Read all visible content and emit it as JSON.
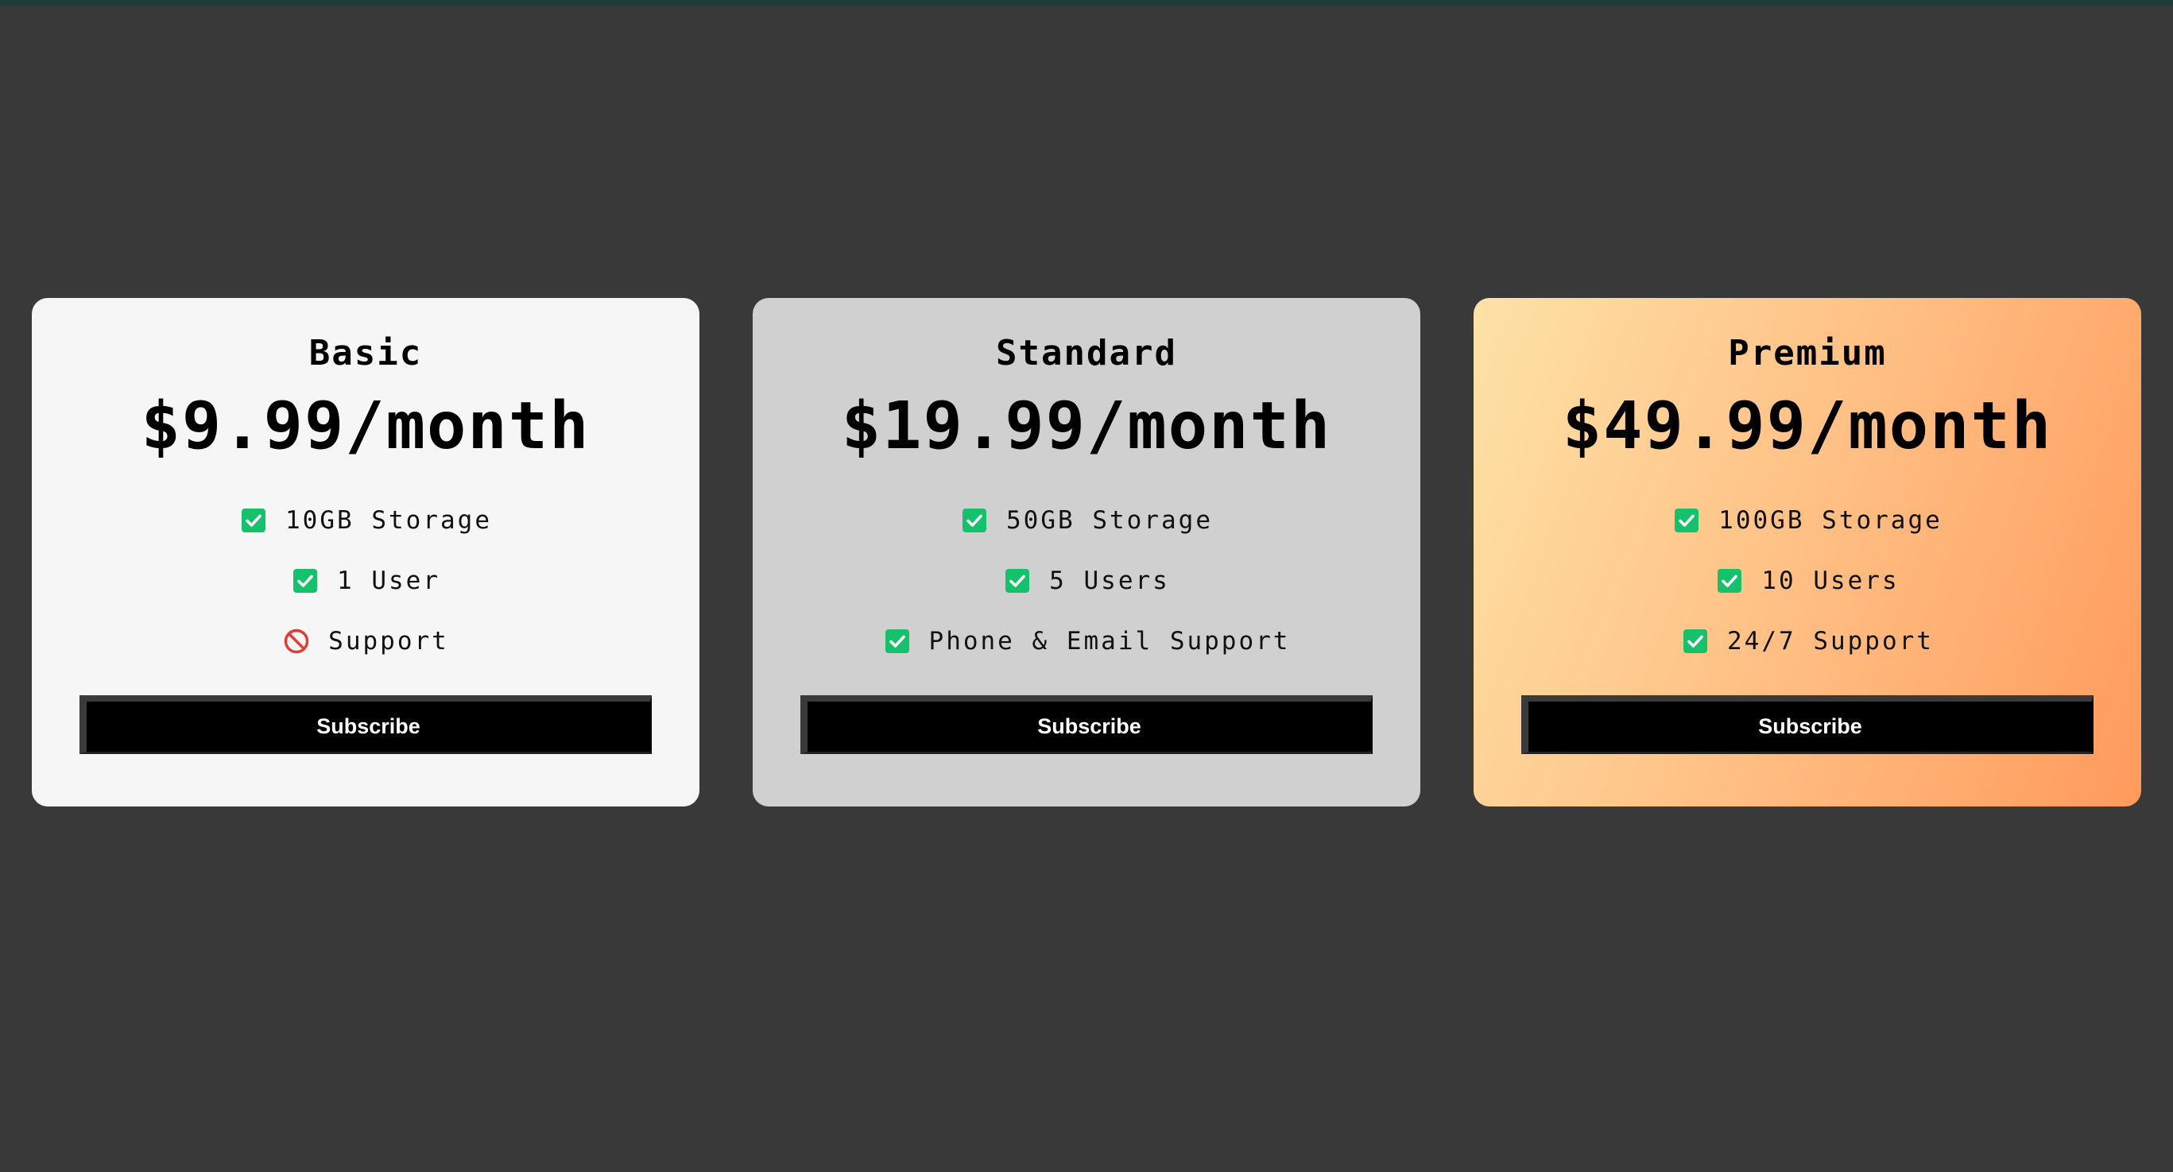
{
  "colors": {
    "background": "#393939",
    "top_strip": "#1f3b35",
    "check": "#13c26a",
    "not_included": "#e53935",
    "basic_card": "#f6f6f6",
    "standard_card": "#d0d0d0",
    "premium_gradient": [
      "#fde2a6",
      "#ff9a5c"
    ],
    "button": "#000000"
  },
  "plans": [
    {
      "name": "Basic",
      "price": "$9.99/month",
      "features": [
        {
          "text": "10GB Storage",
          "included": true,
          "icon": "check-icon"
        },
        {
          "text": "1 User",
          "included": true,
          "icon": "check-icon"
        },
        {
          "text": "Support",
          "included": false,
          "icon": "no-entry-icon"
        }
      ],
      "cta": "Subscribe"
    },
    {
      "name": "Standard",
      "price": "$19.99/month",
      "features": [
        {
          "text": "50GB Storage",
          "included": true,
          "icon": "check-icon"
        },
        {
          "text": "5 Users",
          "included": true,
          "icon": "check-icon"
        },
        {
          "text": "Phone & Email Support",
          "included": true,
          "icon": "check-icon"
        }
      ],
      "cta": "Subscribe"
    },
    {
      "name": "Premium",
      "price": "$49.99/month",
      "features": [
        {
          "text": "100GB Storage",
          "included": true,
          "icon": "check-icon"
        },
        {
          "text": "10 Users",
          "included": true,
          "icon": "check-icon"
        },
        {
          "text": "24/7 Support",
          "included": true,
          "icon": "check-icon"
        }
      ],
      "cta": "Subscribe"
    }
  ]
}
